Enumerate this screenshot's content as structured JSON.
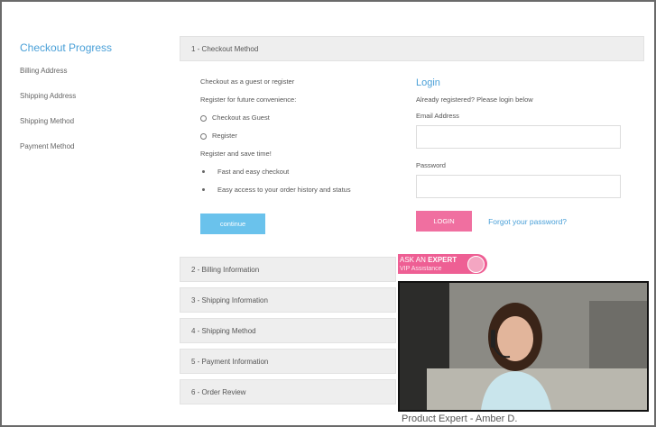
{
  "sidebar": {
    "title": "Checkout Progress",
    "items": [
      "Billing Address",
      "Shipping Address",
      "Shipping Method",
      "Payment Method"
    ]
  },
  "active_step": {
    "label": "1 - Checkout Method",
    "guest_register_text": "Checkout as a guest or register",
    "register_convenience_text": "Register for future convenience:",
    "options": [
      "Checkout as Guest",
      "Register"
    ],
    "save_time_text": "Register and save time!",
    "benefits": [
      "Fast and easy checkout",
      "Easy access to your order history and status"
    ],
    "continue_label": "continue"
  },
  "login": {
    "title": "Login",
    "already_registered": "Already registered? Please login below",
    "email_label": "Email Address",
    "password_label": "Password",
    "login_button": "LOGIN",
    "forgot_link": "Forgot your password?"
  },
  "steps": [
    "2 - Billing Information",
    "3 - Shipping Information",
    "4 - Shipping Method",
    "5 - Payment Information",
    "6 - Order Review"
  ],
  "expert": {
    "badge_prefix": "ASK AN",
    "badge_strong": "EXPERT",
    "badge_sub": "VIP Assistance",
    "caption": "Product Expert - Amber D."
  },
  "colors": {
    "accent_blue": "#4aa0d8",
    "continue_blue": "#6ac2ec",
    "pink": "#f06fa0"
  }
}
